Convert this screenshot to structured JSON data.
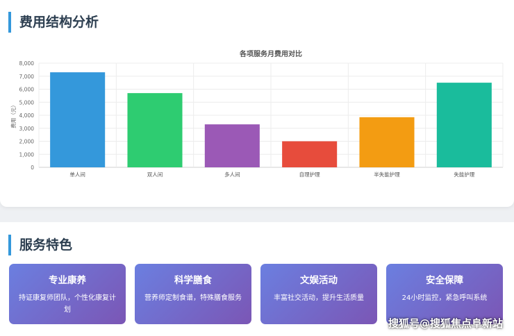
{
  "sections": {
    "cost_title": "费用结构分析",
    "service_title": "服务特色"
  },
  "chart_data": {
    "type": "bar",
    "title": "各项服务月费用对比",
    "xlabel": "",
    "ylabel": "费用（元）",
    "categories": [
      "单人间",
      "双人间",
      "多人间",
      "自理护理",
      "半失能护理",
      "失能护理"
    ],
    "values": [
      7300,
      5700,
      3300,
      2000,
      3850,
      6500
    ],
    "colors": [
      "#3498db",
      "#2ecc71",
      "#9b59b6",
      "#e74c3c",
      "#f39c12",
      "#1abc9c"
    ],
    "ylim": [
      0,
      8000
    ],
    "yticks": [
      0,
      1000,
      2000,
      3000,
      4000,
      5000,
      6000,
      7000,
      8000
    ],
    "ytick_labels": [
      "0",
      "1,000",
      "2,000",
      "3,000",
      "4,000",
      "5,000",
      "6,000",
      "7,000",
      "8,000"
    ],
    "grid": true,
    "legend": "none"
  },
  "features": [
    {
      "title": "专业康养",
      "desc": "持证康复师团队，个性化康复计划"
    },
    {
      "title": "科学膳食",
      "desc": "营养师定制食谱，特殊膳食服务"
    },
    {
      "title": "文娱活动",
      "desc": "丰富社交活动，提升生活质量"
    },
    {
      "title": "安全保障",
      "desc": "24小时监控，紧急呼叫系统"
    }
  ],
  "watermark": "搜狐号@搜狐焦点阜新站"
}
